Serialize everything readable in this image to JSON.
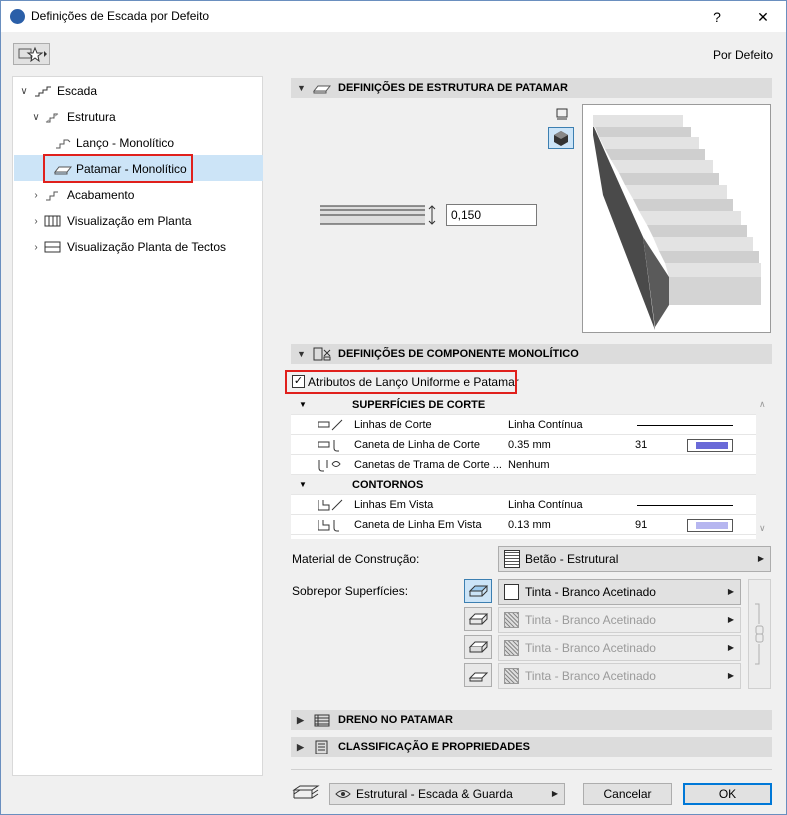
{
  "window": {
    "title": "Definições de Escada por Defeito",
    "help_label": "?",
    "close_label": "✕",
    "favorites_icon": "star-icon",
    "defaults_label": "Por Defeito"
  },
  "tree": {
    "items": [
      {
        "label": "Escada"
      },
      {
        "label": "Estrutura"
      },
      {
        "label": "Lanço - Monolítico"
      },
      {
        "label": "Patamar - Monolítico"
      },
      {
        "label": "Acabamento"
      },
      {
        "label": "Visualização em Planta"
      },
      {
        "label": "Visualização Planta de Tectos"
      }
    ]
  },
  "landing_structure": {
    "header": "DEFINIÇÕES DE ESTRUTURA DE PATAMAR",
    "thickness_value": "0,150"
  },
  "monolithic": {
    "header": "DEFINIÇÕES DE COMPONENTE MONOLÍTICO",
    "uniform_checkbox_label": "Atributos de Lanço Uniforme e Patamar",
    "uniform_checked": true,
    "cut_surfaces_header": "SUPERFÍCIES DE CORTE",
    "rows_cut": [
      {
        "name": "Linhas de Corte",
        "value": "Linha Contínua",
        "num": ""
      },
      {
        "name": "Caneta de Linha de Corte",
        "value": "0.35 mm",
        "num": "31"
      },
      {
        "name": "Canetas de Trama de Corte ...",
        "value": "Nenhum",
        "num": ""
      }
    ],
    "contours_header": "CONTORNOS",
    "rows_contours": [
      {
        "name": "Linhas Em Vista",
        "value": "Linha Contínua",
        "num": ""
      },
      {
        "name": "Caneta de Linha Em Vista",
        "value": "0.13 mm",
        "num": "91"
      }
    ],
    "material_label": "Material de Construção:",
    "material_value": "Betão - Estrutural",
    "override_label": "Sobrepor Superfícies:",
    "surfaces": [
      {
        "value": "Tinta - Branco Acetinado",
        "enabled": true
      },
      {
        "value": "Tinta - Branco Acetinado",
        "enabled": false
      },
      {
        "value": "Tinta - Branco Acetinado",
        "enabled": false
      },
      {
        "value": "Tinta - Branco Acetinado",
        "enabled": false
      }
    ]
  },
  "drain": {
    "header": "DRENO NO PATAMAR"
  },
  "classification": {
    "header": "CLASSIFICAÇÃO E PROPRIEDADES"
  },
  "footer": {
    "layer_value": "Estrutural - Escada & Guarda",
    "cancel_label": "Cancelar",
    "ok_label": "OK"
  },
  "colors": {
    "selection": "#cce4f7",
    "highlight_box": "#e0201c",
    "accent": "#0078d7"
  }
}
